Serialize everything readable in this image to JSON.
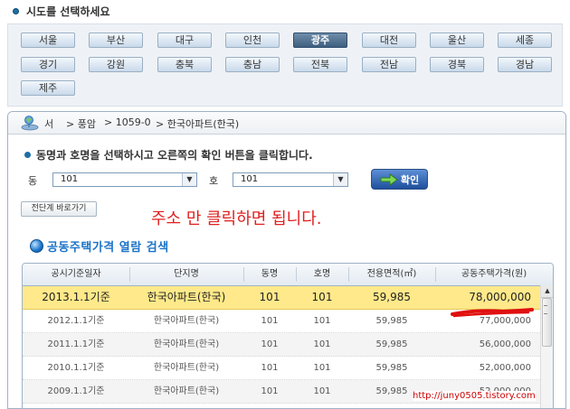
{
  "region": {
    "title": "시도를 선택하세요",
    "buttons": [
      {
        "label": "서울",
        "active": false
      },
      {
        "label": "부산",
        "active": false
      },
      {
        "label": "대구",
        "active": false
      },
      {
        "label": "인천",
        "active": false
      },
      {
        "label": "광주",
        "active": true
      },
      {
        "label": "대전",
        "active": false
      },
      {
        "label": "울산",
        "active": false
      },
      {
        "label": "세종",
        "active": false
      },
      {
        "label": "경기",
        "active": false
      },
      {
        "label": "강원",
        "active": false
      },
      {
        "label": "충북",
        "active": false
      },
      {
        "label": "충남",
        "active": false
      },
      {
        "label": "전북",
        "active": false
      },
      {
        "label": "전남",
        "active": false
      },
      {
        "label": "경북",
        "active": false
      },
      {
        "label": "경남",
        "active": false
      },
      {
        "label": "제주",
        "active": false
      }
    ]
  },
  "breadcrumb": [
    "서",
    "> 풍암",
    "> 1059-0",
    "> 한국아파트(한국)"
  ],
  "instruction": "동명과 호명을 선택하시고 오른쪽의 확인 버튼을 클릭합니다.",
  "form": {
    "dong_label": "동",
    "dong_value": "101",
    "ho_label": "호",
    "ho_value": "101",
    "confirm_label": "확인",
    "back_label": "전단계 바로가기"
  },
  "annotation": "주소 만 클릭하면 됩니다.",
  "section_title": "공동주택가격 열람 검색",
  "table": {
    "headers": [
      "공시기준일자",
      "단지명",
      "동명",
      "호명",
      "전용면적(㎡)",
      "공동주택가격(원)"
    ],
    "rows": [
      {
        "date": "2013.1.1기준",
        "name": "한국아파트(한국)",
        "dong": "101",
        "ho": "101",
        "area": "59,985",
        "price": "78,000,000"
      },
      {
        "date": "2012.1.1기준",
        "name": "한국아파트(한국)",
        "dong": "101",
        "ho": "101",
        "area": "59,985",
        "price": "77,000,000"
      },
      {
        "date": "2011.1.1기준",
        "name": "한국아파트(한국)",
        "dong": "101",
        "ho": "101",
        "area": "59,985",
        "price": "56,000,000"
      },
      {
        "date": "2010.1.1기준",
        "name": "한국아파트(한국)",
        "dong": "101",
        "ho": "101",
        "area": "59,985",
        "price": "52,000,000"
      },
      {
        "date": "2009.1.1기준",
        "name": "한국아파트(한국)",
        "dong": "101",
        "ho": "101",
        "area": "59,985",
        "price": "52,000,000"
      }
    ]
  },
  "watermark": "http://juny0505.tistory.com",
  "colors": {
    "accent": "#1a73c8",
    "highlight_row": "#ffe98a",
    "annotation": "#e02020",
    "active_region": "#3f5f80"
  }
}
